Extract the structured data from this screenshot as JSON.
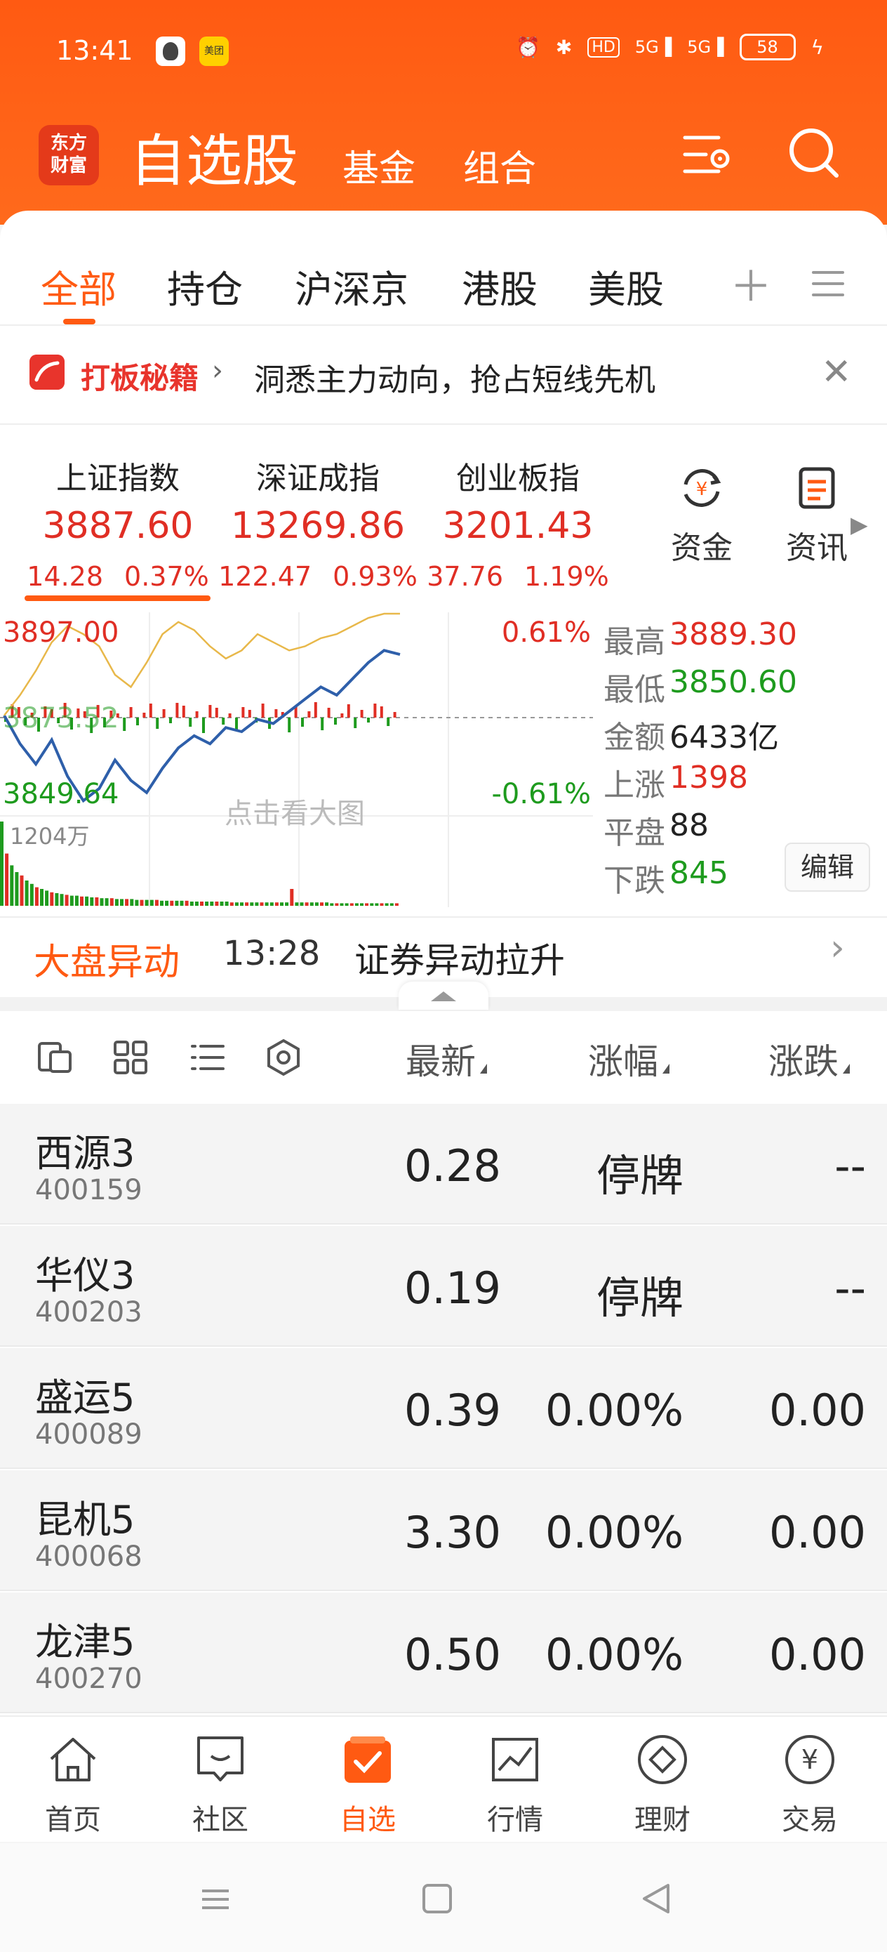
{
  "status": {
    "time": "13:41",
    "battery": "58",
    "app2": "美团",
    "icons": [
      "alarm-icon",
      "bluetooth-icon",
      "hd-icon",
      "5g-signal-icon",
      "5g-signal-icon",
      "charging-icon"
    ]
  },
  "header": {
    "logo": "东方\n财富",
    "title": "自选股",
    "tabs": [
      "基金",
      "组合"
    ]
  },
  "subtabs": [
    "全部",
    "持仓",
    "沪深京",
    "港股",
    "美股"
  ],
  "promo": {
    "brand": "打板秘籍",
    "text": "洞悉主力动向，抢占短线先机"
  },
  "indices": [
    {
      "name": "上证指数",
      "value": "3887.60",
      "change": "14.28",
      "pct": "0.37%"
    },
    {
      "name": "深证成指",
      "value": "13269.86",
      "change": "122.47",
      "pct": "0.93%"
    },
    {
      "name": "创业板指",
      "value": "3201.43",
      "change": "37.76",
      "pct": "1.19%"
    }
  ],
  "quick": [
    {
      "label": "资金",
      "icon": "yuan-exchange-icon"
    },
    {
      "label": "资讯",
      "icon": "news-icon"
    }
  ],
  "chart": {
    "high_label": "3897.00",
    "low_label": "3849.64",
    "mid_label": "3873.52",
    "pct_up": "0.61%",
    "pct_down": "-0.61%",
    "volume_label": "1204万",
    "hint": "点击看大图"
  },
  "chart_data": {
    "type": "line",
    "ylim": [
      3849.64,
      3897.0
    ],
    "series": [
      {
        "values": [
          3873,
          3866,
          3861,
          3867,
          3858,
          3852,
          3855,
          3862,
          3857,
          3854,
          3860,
          3865,
          3868,
          3866,
          3870,
          3869,
          3872,
          3871,
          3874,
          3877,
          3880,
          3878,
          3882,
          3886,
          3889,
          3888
        ]
      },
      {
        "values": [
          3873,
          3878,
          3884,
          3891,
          3895,
          3893,
          3890,
          3883,
          3880,
          3886,
          3893,
          3896,
          3894,
          3890,
          3887,
          3889,
          3893,
          3891,
          3889,
          3890,
          3892,
          3893,
          3895,
          3897,
          3899,
          3900
        ]
      }
    ],
    "volume": [
      100,
      62,
      48,
      40,
      36,
      30,
      26,
      22,
      20,
      18,
      16,
      15,
      14,
      13,
      12,
      12,
      11,
      11,
      10,
      10,
      9,
      9,
      9,
      8,
      8,
      8,
      8,
      7,
      7,
      7,
      7,
      7,
      6,
      6,
      6,
      6,
      6,
      6,
      5,
      5,
      5,
      5,
      5,
      5,
      5,
      5,
      4,
      4,
      4,
      4,
      4,
      4,
      4,
      4,
      4,
      4,
      4,
      4,
      20,
      4,
      4,
      4,
      4,
      4,
      4,
      4,
      3,
      3,
      3,
      3,
      3,
      3,
      3,
      3,
      3,
      3,
      3,
      3,
      3,
      3
    ]
  },
  "market": {
    "high_label": "最高",
    "high": "3889.30",
    "low_label": "最低",
    "low": "3850.60",
    "amount_label": "金额",
    "amount": "6433亿",
    "up_label": "上涨",
    "up": "1398",
    "flat_label": "平盘",
    "flat": "88",
    "down_label": "下跌",
    "down": "845",
    "edit": "编辑"
  },
  "alert": {
    "title": "大盘异动",
    "time": "13:28",
    "text": "证券异动拉升"
  },
  "columns": {
    "latest": "最新",
    "pct": "涨幅",
    "chg": "涨跌"
  },
  "stocks": [
    {
      "name": "西源3",
      "code": "400159",
      "price": "0.28",
      "pct": "停牌",
      "chg": "--"
    },
    {
      "name": "华仪3",
      "code": "400203",
      "price": "0.19",
      "pct": "停牌",
      "chg": "--"
    },
    {
      "name": "盛运5",
      "code": "400089",
      "price": "0.39",
      "pct": "0.00%",
      "chg": "0.00"
    },
    {
      "name": "昆机5",
      "code": "400068",
      "price": "3.30",
      "pct": "0.00%",
      "chg": "0.00"
    },
    {
      "name": "龙津5",
      "code": "400270",
      "price": "0.50",
      "pct": "0.00%",
      "chg": "0.00"
    }
  ],
  "bottom_nav": [
    {
      "label": "首页",
      "icon": "home-icon"
    },
    {
      "label": "社区",
      "icon": "chat-icon"
    },
    {
      "label": "自选",
      "icon": "checkbox-icon"
    },
    {
      "label": "行情",
      "icon": "chart-icon"
    },
    {
      "label": "理财",
      "icon": "diamond-icon"
    },
    {
      "label": "交易",
      "icon": "yuan-icon"
    }
  ],
  "colors": {
    "brand": "#ff5a12",
    "up": "#e02e24",
    "down": "#1e9b1e"
  }
}
